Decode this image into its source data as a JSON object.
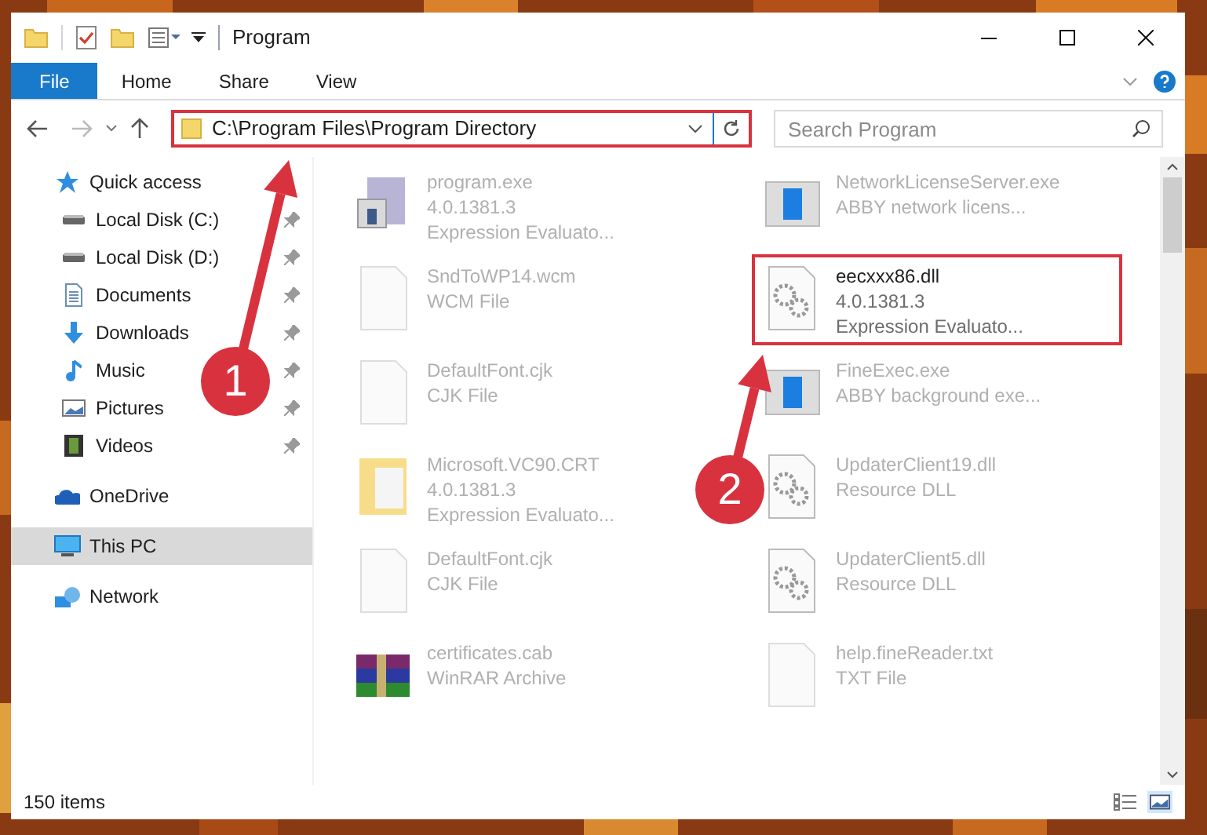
{
  "window": {
    "title": "Program"
  },
  "ribbon_tabs": [
    {
      "label": "File",
      "selected": true
    },
    {
      "label": "Home",
      "selected": false
    },
    {
      "label": "Share",
      "selected": false
    },
    {
      "label": "View",
      "selected": false
    }
  ],
  "address_bar": {
    "path": "C:\\Program Files\\Program Directory",
    "highlighted": true
  },
  "search": {
    "placeholder": "Search Program"
  },
  "navigation": [
    {
      "label": "Quick access",
      "kind": "star",
      "selected": false,
      "children": [
        {
          "label": "Local Disk (C:)",
          "kind": "disk",
          "pinned": true
        },
        {
          "label": "Local Disk (D:)",
          "kind": "disk",
          "pinned": true
        },
        {
          "label": "Documents",
          "kind": "doc",
          "pinned": true
        },
        {
          "label": "Downloads",
          "kind": "download",
          "pinned": true
        },
        {
          "label": "Music",
          "kind": "music",
          "pinned": true
        },
        {
          "label": "Pictures",
          "kind": "pictures",
          "pinned": true
        },
        {
          "label": "Videos",
          "kind": "videos",
          "pinned": true
        }
      ]
    },
    {
      "label": "OneDrive",
      "kind": "cloud",
      "selected": false
    },
    {
      "label": "This PC",
      "kind": "pc",
      "selected": true
    },
    {
      "label": "Network",
      "kind": "network",
      "selected": false
    }
  ],
  "files": [
    {
      "name": "program.exe",
      "lines": [
        "4.0.1381.3",
        "Expression Evaluato..."
      ],
      "kind": "exe",
      "highlighted": false
    },
    {
      "name": "NetworkLicenseServer.exe",
      "lines": [
        "ABBY network licens..."
      ],
      "kind": "app",
      "highlighted": false
    },
    {
      "name": "SndToWP14.wcm",
      "lines": [
        "WCM File"
      ],
      "kind": "blank",
      "highlighted": false
    },
    {
      "name": "eecxxx86.dll",
      "lines": [
        "4.0.1381.3",
        "Expression Evaluato..."
      ],
      "kind": "dll",
      "highlighted": true
    },
    {
      "name": "DefaultFont.cjk",
      "lines": [
        "CJK File"
      ],
      "kind": "blank",
      "highlighted": false
    },
    {
      "name": "FineExec.exe",
      "lines": [
        "ABBY background exe..."
      ],
      "kind": "app",
      "highlighted": false
    },
    {
      "name": "Microsoft.VC90.CRT",
      "lines": [
        "4.0.1381.3",
        "Expression Evaluato..."
      ],
      "kind": "folder",
      "highlighted": false
    },
    {
      "name": "UpdaterClient19.dll",
      "lines": [
        "Resource DLL"
      ],
      "kind": "dll",
      "highlighted": false
    },
    {
      "name": "DefaultFont.cjk",
      "lines": [
        "CJK File"
      ],
      "kind": "blank",
      "highlighted": false
    },
    {
      "name": "UpdaterClient5.dll",
      "lines": [
        "Resource DLL"
      ],
      "kind": "dll",
      "highlighted": false
    },
    {
      "name": "certificates.cab",
      "lines": [
        "WinRAR Archive"
      ],
      "kind": "archive",
      "highlighted": false
    },
    {
      "name": "help.fineReader.txt",
      "lines": [
        "TXT File"
      ],
      "kind": "blank",
      "highlighted": false
    }
  ],
  "status_bar": {
    "item_count": "150 items"
  },
  "callouts": [
    {
      "number": "1"
    },
    {
      "number": "2"
    }
  ]
}
